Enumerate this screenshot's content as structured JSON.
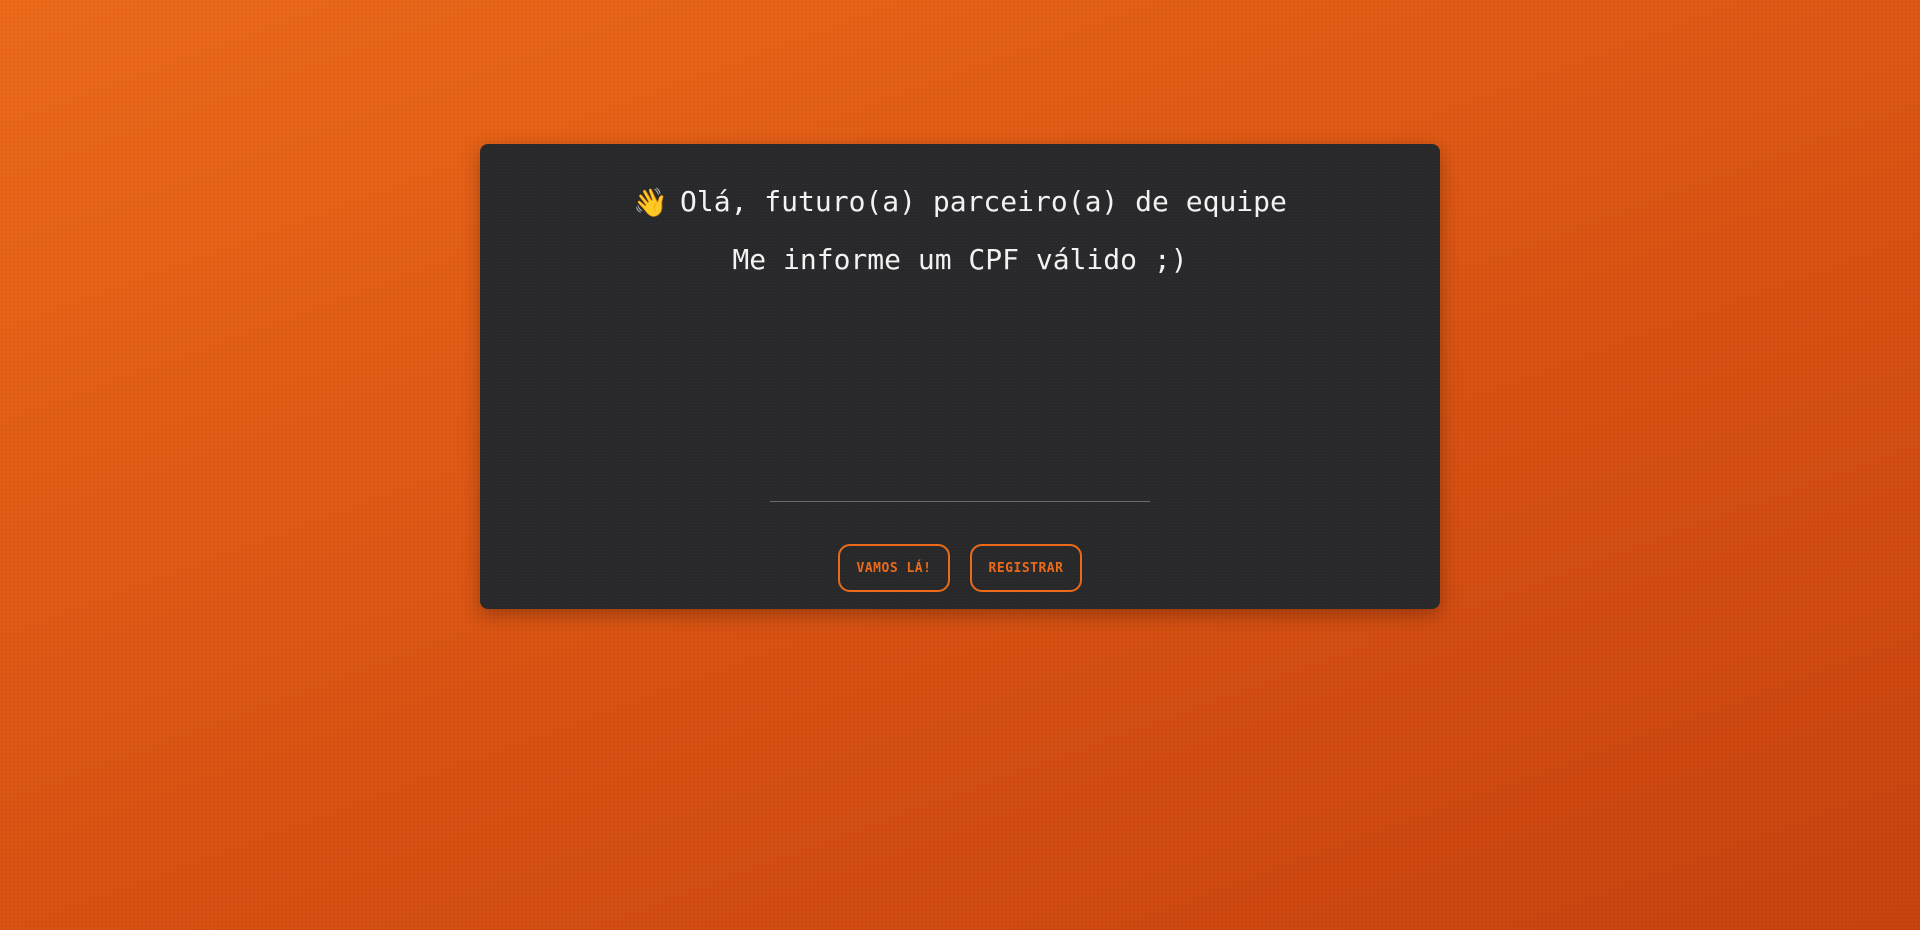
{
  "card": {
    "greeting_icon": "waving-hand-icon",
    "greeting_emoji": "👋",
    "greeting_text": "Olá, futuro(a) parceiro(a) de equipe",
    "subtitle": "Me informe um CPF válido ;)"
  },
  "cpf_input": {
    "value": "",
    "placeholder": ""
  },
  "buttons": {
    "primary_label": "VAMOS LÁ!",
    "secondary_label": "REGISTRAR"
  },
  "colors": {
    "accent": "#ec6a1a",
    "card_background": "#27282a",
    "text": "#f2f2f2"
  }
}
